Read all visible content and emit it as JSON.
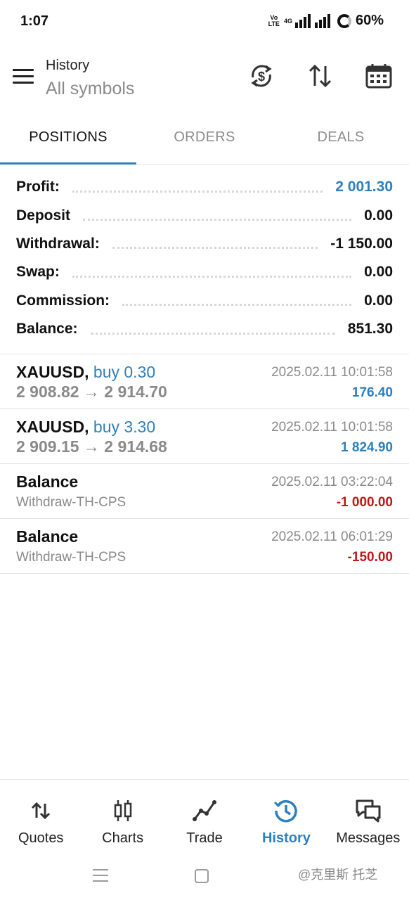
{
  "status_bar": {
    "time": "1:07",
    "volte_top": "Vo",
    "volte_bottom": "LTE",
    "network": "4G",
    "battery": "60%"
  },
  "header": {
    "title": "History",
    "subtitle": "All symbols",
    "icons": [
      "currency-sync-icon",
      "sort-icon",
      "calendar-icon"
    ]
  },
  "tabs": [
    {
      "label": "POSITIONS",
      "active": true
    },
    {
      "label": "ORDERS",
      "active": false
    },
    {
      "label": "DEALS",
      "active": false
    }
  ],
  "summary": [
    {
      "label": "Profit:",
      "value": "2 001.30"
    },
    {
      "label": "Deposit",
      "value": "0.00"
    },
    {
      "label": "Withdrawal:",
      "value": "-1 150.00"
    },
    {
      "label": "Swap:",
      "value": "0.00"
    },
    {
      "label": "Commission:",
      "value": "0.00"
    },
    {
      "label": "Balance:",
      "value": "851.30"
    }
  ],
  "history": [
    {
      "symbol": "XAUUSD,",
      "side": "buy 0.30",
      "price": "2 908.82 → 2 914.70",
      "time": "2025.02.11 10:01:58",
      "profit": "176.40"
    },
    {
      "symbol": "XAUUSD,",
      "side": "buy 3.30",
      "price": "2 909.15 → 2 914.68",
      "time": "2025.02.11 10:01:58",
      "profit": "1 824.90"
    },
    {
      "symbol": "Balance",
      "comment": "Withdraw-TH-CPS",
      "time": "2025.02.11 03:22:04",
      "profit": "-1 000.00"
    },
    {
      "symbol": "Balance",
      "comment": "Withdraw-TH-CPS",
      "time": "2025.02.11 06:01:29",
      "profit": "-150.00"
    }
  ],
  "bottom_nav": [
    {
      "label": "Quotes",
      "icon": "quotes-icon"
    },
    {
      "label": "Charts",
      "icon": "charts-icon"
    },
    {
      "label": "Trade",
      "icon": "trade-icon"
    },
    {
      "label": "History",
      "icon": "history-icon",
      "active": true
    },
    {
      "label": "Messages",
      "icon": "messages-icon"
    }
  ],
  "watermark": "@克里斯 托芝",
  "colors": {
    "accent": "#2d7fbf",
    "negative": "#c01818",
    "muted": "#8a8a8a"
  }
}
